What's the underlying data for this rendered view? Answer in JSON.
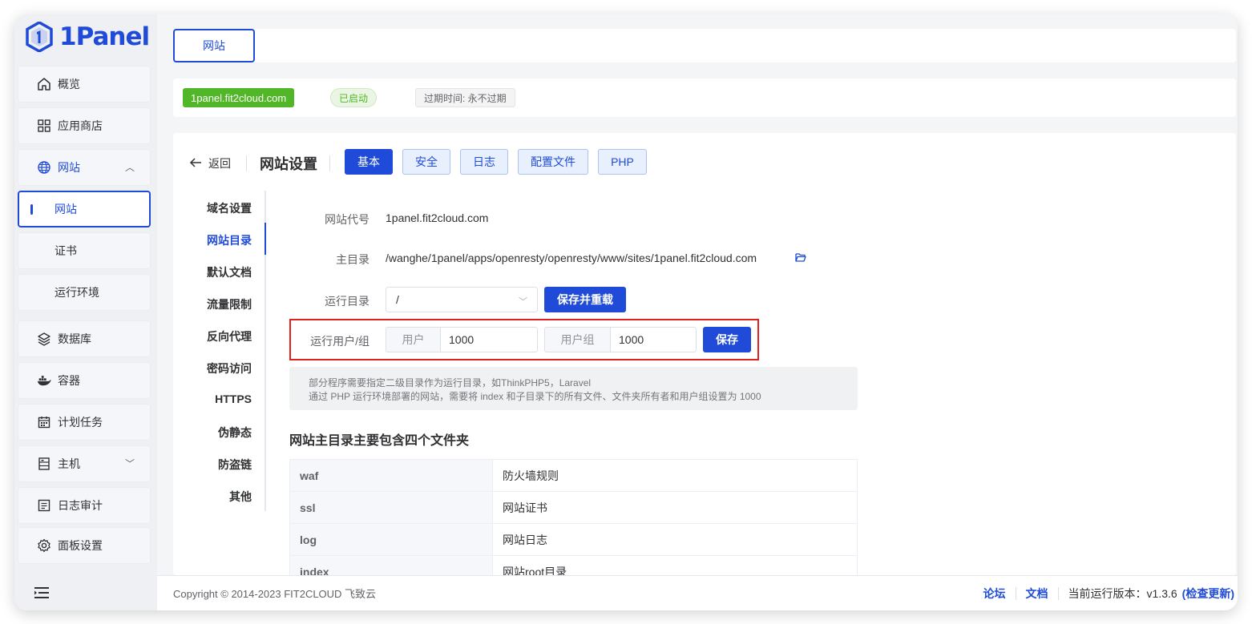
{
  "app": {
    "logo_text": "1Panel"
  },
  "sidebar": {
    "items": [
      {
        "label": "概览",
        "icon": "home-icon"
      },
      {
        "label": "应用商店",
        "icon": "grid-icon"
      },
      {
        "label": "网站",
        "icon": "globe-icon"
      },
      {
        "label": "网站"
      },
      {
        "label": "证书"
      },
      {
        "label": "运行环境"
      },
      {
        "label": "数据库",
        "icon": "layers-icon"
      },
      {
        "label": "容器",
        "icon": "docker-icon"
      },
      {
        "label": "计划任务",
        "icon": "calendar-icon"
      },
      {
        "label": "主机",
        "icon": "server-icon"
      },
      {
        "label": "日志审计",
        "icon": "log-icon"
      },
      {
        "label": "面板设置",
        "icon": "gear-icon"
      }
    ]
  },
  "topbar": {
    "tab_label": "网站"
  },
  "info": {
    "domain": "1panel.fit2cloud.com",
    "status": "已启动",
    "expire": "过期时间: 永不过期"
  },
  "header": {
    "back": "返回",
    "title": "网站设置",
    "tabs": [
      "基本",
      "安全",
      "日志",
      "配置文件",
      "PHP"
    ]
  },
  "left_menu": [
    "域名设置",
    "网站目录",
    "默认文档",
    "流量限制",
    "反向代理",
    "密码访问",
    "HTTPS",
    "伪静态",
    "防盗链",
    "其他"
  ],
  "form": {
    "site_code_label": "网站代号",
    "site_code": "1panel.fit2cloud.com",
    "root_label": "主目录",
    "root_path": "/wanghe/1panel/apps/openresty/openresty/www/sites/1panel.fit2cloud.com",
    "run_dir_label": "运行目录",
    "run_dir_value": "/",
    "save_reload": "保存并重载",
    "run_user_label": "运行用户/组",
    "user_prefix": "用户",
    "user_value": "1000",
    "group_prefix": "用户组",
    "group_value": "1000",
    "save": "保存",
    "hint_line1": "部分程序需要指定二级目录作为运行目录，如ThinkPHP5，Laravel",
    "hint_line2": "通过 PHP 运行环境部署的网站，需要将 index 和子目录下的所有文件、文件夹所有者和用户组设置为 1000"
  },
  "dirs": {
    "title": "网站主目录主要包含四个文件夹",
    "rows": [
      {
        "name": "waf",
        "desc": "防火墙规则"
      },
      {
        "name": "ssl",
        "desc": "网站证书"
      },
      {
        "name": "log",
        "desc": "网站日志"
      },
      {
        "name": "index",
        "desc": "网站root目录"
      }
    ]
  },
  "footer": {
    "copyright": "Copyright © 2014-2023 FIT2CLOUD 飞致云",
    "forum": "论坛",
    "docs": "文档",
    "version_label": "当前运行版本：v1.3.6",
    "check_update": "(检查更新)"
  },
  "colors": {
    "primary": "#1f4bd8",
    "success": "#52b728",
    "highlight": "#e02020"
  }
}
